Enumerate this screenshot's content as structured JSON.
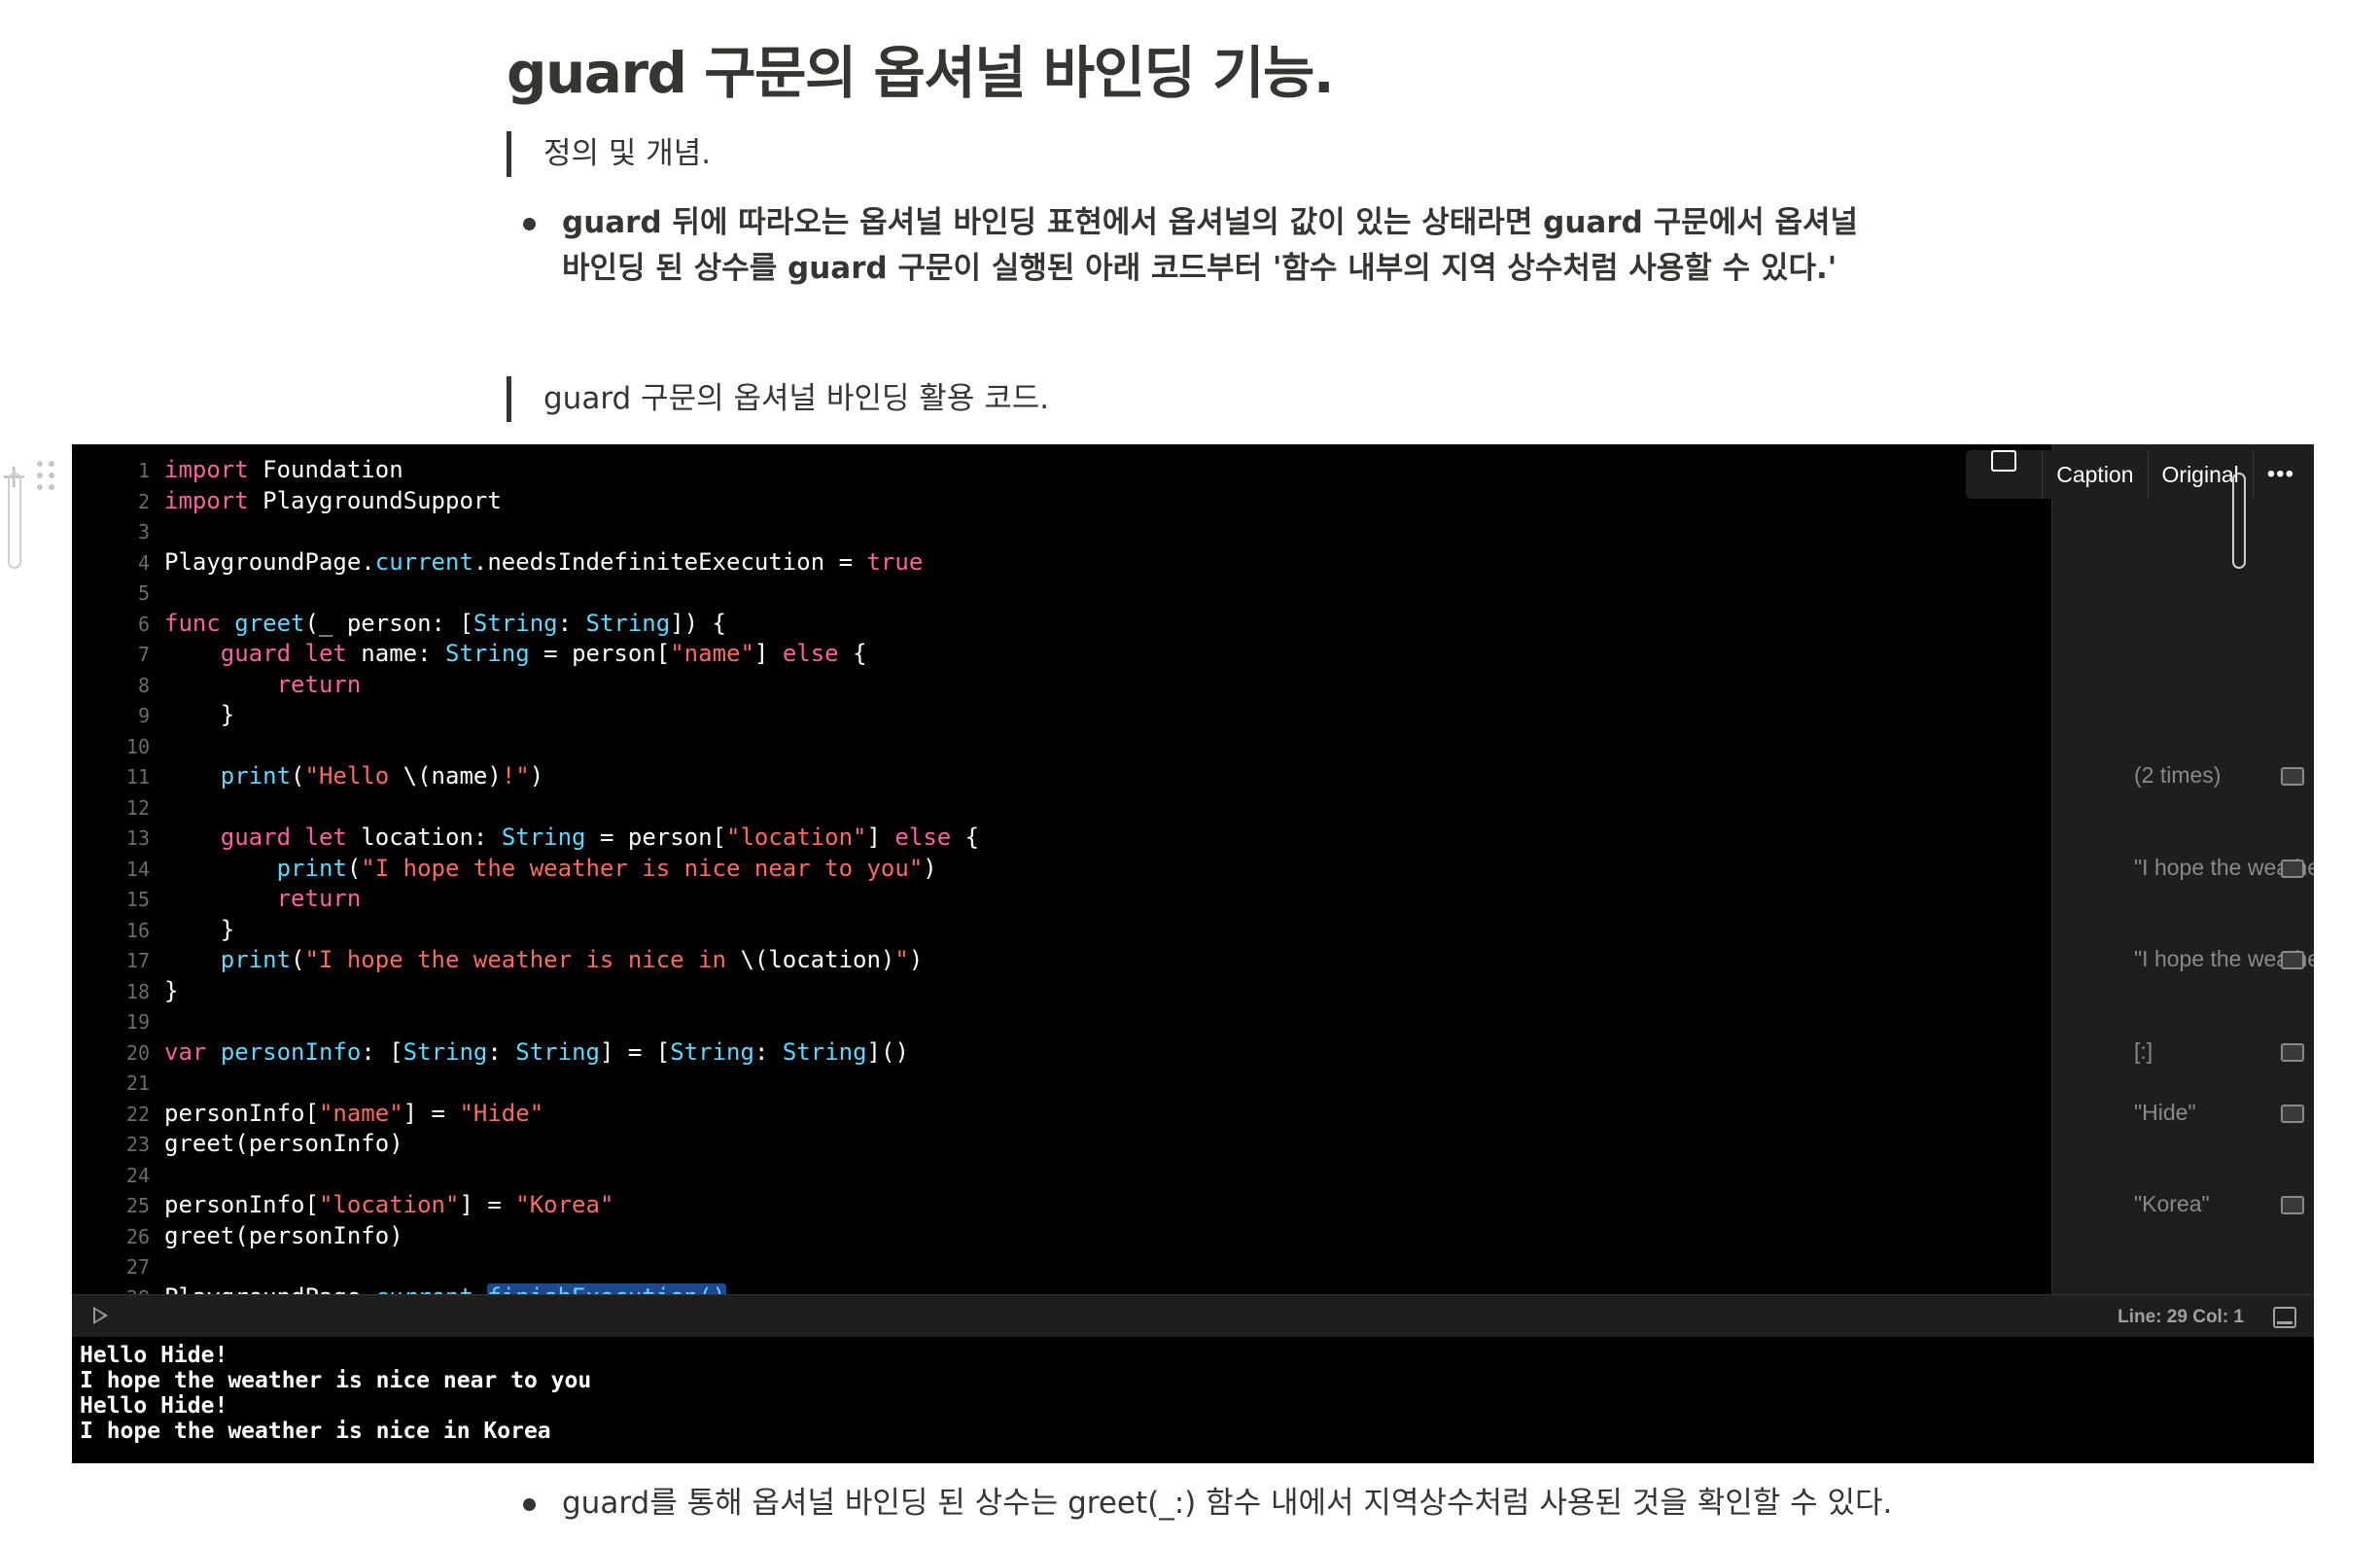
{
  "page": {
    "title": "guard 구문의 옵셔널 바인딩 기능.",
    "quote1": "정의 및 개념.",
    "bullet1": "guard 뒤에 따라오는 옵셔널 바인딩 표현에서 옵셔널의 값이 있는 상태라면 guard 구문에서 옵셔널 바인딩 된 상수를 guard 구문이 실행된 아래 코드부터 '함수 내부의 지역 상수처럼 사용할 수 있다.'",
    "quote2": "guard 구문의 옵셔널 바인딩 활용 코드.",
    "bullet2": "guard를 통해 옵셔널 바인딩 된 상수는 greet(_:) 함수 내에서 지역상수처럼 사용된 것을 확인할 수 있다."
  },
  "toolbar": {
    "caption": "Caption",
    "original": "Original",
    "more": "•••"
  },
  "code_lines": [
    [
      {
        "t": "import",
        "c": "kw"
      },
      {
        "t": " Foundation"
      }
    ],
    [
      {
        "t": "import",
        "c": "kw"
      },
      {
        "t": " PlaygroundSupport"
      }
    ],
    [],
    [
      {
        "t": "PlaygroundPage."
      },
      {
        "t": "current",
        "c": "ty"
      },
      {
        "t": ".needsIndefiniteExecution = "
      },
      {
        "t": "true",
        "c": "kw"
      }
    ],
    [],
    [
      {
        "t": "func",
        "c": "kw"
      },
      {
        "t": " "
      },
      {
        "t": "greet",
        "c": "ty"
      },
      {
        "t": "(_ person: ["
      },
      {
        "t": "String",
        "c": "ty"
      },
      {
        "t": ": "
      },
      {
        "t": "String",
        "c": "ty"
      },
      {
        "t": "]) {"
      }
    ],
    [
      {
        "t": "    "
      },
      {
        "t": "guard",
        "c": "kw"
      },
      {
        "t": " "
      },
      {
        "t": "let",
        "c": "kw"
      },
      {
        "t": " name: "
      },
      {
        "t": "String",
        "c": "ty"
      },
      {
        "t": " = person["
      },
      {
        "t": "\"name\"",
        "c": "st"
      },
      {
        "t": "] "
      },
      {
        "t": "else",
        "c": "kw"
      },
      {
        "t": " {"
      }
    ],
    [
      {
        "t": "        "
      },
      {
        "t": "return",
        "c": "kw"
      }
    ],
    [
      {
        "t": "    }"
      }
    ],
    [],
    [
      {
        "t": "    "
      },
      {
        "t": "print",
        "c": "ty"
      },
      {
        "t": "("
      },
      {
        "t": "\"Hello ",
        "c": "st"
      },
      {
        "t": "\\(name)"
      },
      {
        "t": "!\"",
        "c": "st"
      },
      {
        "t": ")"
      }
    ],
    [],
    [
      {
        "t": "    "
      },
      {
        "t": "guard",
        "c": "kw"
      },
      {
        "t": " "
      },
      {
        "t": "let",
        "c": "kw"
      },
      {
        "t": " location: "
      },
      {
        "t": "String",
        "c": "ty"
      },
      {
        "t": " = person["
      },
      {
        "t": "\"location\"",
        "c": "st"
      },
      {
        "t": "] "
      },
      {
        "t": "else",
        "c": "kw"
      },
      {
        "t": " {"
      }
    ],
    [
      {
        "t": "        "
      },
      {
        "t": "print",
        "c": "ty"
      },
      {
        "t": "("
      },
      {
        "t": "\"I hope the weather is nice near to you\"",
        "c": "st"
      },
      {
        "t": ")"
      }
    ],
    [
      {
        "t": "        "
      },
      {
        "t": "return",
        "c": "kw"
      }
    ],
    [
      {
        "t": "    }"
      }
    ],
    [
      {
        "t": "    "
      },
      {
        "t": "print",
        "c": "ty"
      },
      {
        "t": "("
      },
      {
        "t": "\"I hope the weather is nice in ",
        "c": "st"
      },
      {
        "t": "\\(location)"
      },
      {
        "t": "\"",
        "c": "st"
      },
      {
        "t": ")"
      }
    ],
    [
      {
        "t": "}"
      }
    ],
    [],
    [
      {
        "t": "var",
        "c": "kw"
      },
      {
        "t": " "
      },
      {
        "t": "personInfo",
        "c": "ty"
      },
      {
        "t": ": ["
      },
      {
        "t": "String",
        "c": "ty"
      },
      {
        "t": ": "
      },
      {
        "t": "String",
        "c": "ty"
      },
      {
        "t": "] = ["
      },
      {
        "t": "String",
        "c": "ty"
      },
      {
        "t": ": "
      },
      {
        "t": "String",
        "c": "ty"
      },
      {
        "t": "]()"
      }
    ],
    [],
    [
      {
        "t": "personInfo["
      },
      {
        "t": "\"name\"",
        "c": "st"
      },
      {
        "t": "] = "
      },
      {
        "t": "\"Hide\"",
        "c": "st"
      }
    ],
    [
      {
        "t": "greet(personInfo)"
      }
    ],
    [],
    [
      {
        "t": "personInfo["
      },
      {
        "t": "\"location\"",
        "c": "st"
      },
      {
        "t": "] = "
      },
      {
        "t": "\"Korea\"",
        "c": "st"
      }
    ],
    [
      {
        "t": "greet(personInfo)"
      }
    ],
    [],
    [
      {
        "t": "PlaygroundPage."
      },
      {
        "t": "current",
        "c": "ty"
      },
      {
        "t": "."
      },
      {
        "t": "finishExecution()",
        "c": "ty sel"
      }
    ]
  ],
  "results": [
    {
      "line": 11,
      "text": "(2 times)"
    },
    {
      "line": 14,
      "text": "\"I hope the weather..."
    },
    {
      "line": 17,
      "text": "\"I hope the weather..."
    },
    {
      "line": 20,
      "text": "[:]"
    },
    {
      "line": 22,
      "text": "\"Hide\""
    },
    {
      "line": 25,
      "text": "\"Korea\""
    }
  ],
  "status": "Line: 29  Col: 1",
  "console": [
    "Hello Hide!",
    "I hope the weather is nice near to you",
    "Hello Hide!",
    "I hope the weather is nice in Korea"
  ],
  "icons": [
    "plus-icon",
    "drag-handle-icon",
    "comment-icon",
    "more-icon",
    "run-icon",
    "console-toggle-icon",
    "result-view-icon"
  ]
}
